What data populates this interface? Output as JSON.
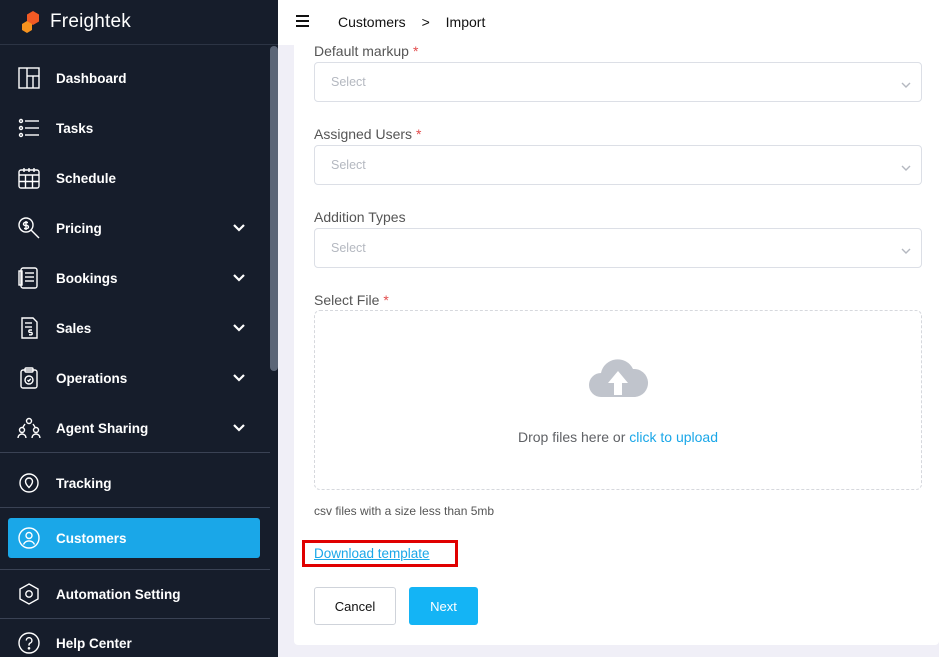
{
  "brand": {
    "name": "Freightek",
    "accent": "#f15a24"
  },
  "sidebar": {
    "items": [
      {
        "label": "Dashboard",
        "icon": "dashboard-icon",
        "expandable": false
      },
      {
        "label": "Tasks",
        "icon": "tasks-icon",
        "expandable": false
      },
      {
        "label": "Schedule",
        "icon": "calendar-icon",
        "expandable": false
      },
      {
        "label": "Pricing",
        "icon": "pricing-search-icon",
        "expandable": true
      },
      {
        "label": "Bookings",
        "icon": "bookings-icon",
        "expandable": true
      },
      {
        "label": "Sales",
        "icon": "sales-invoice-icon",
        "expandable": true
      },
      {
        "label": "Operations",
        "icon": "clipboard-icon",
        "expandable": true
      },
      {
        "label": "Agent Sharing",
        "icon": "agents-icon",
        "expandable": true
      },
      {
        "label": "Tracking",
        "icon": "location-pin-icon",
        "expandable": false
      },
      {
        "label": "Customers",
        "icon": "customer-icon",
        "expandable": false,
        "active": true
      },
      {
        "label": "Automation Setting",
        "icon": "hexagon-gear-icon",
        "expandable": false
      },
      {
        "label": "Help Center",
        "icon": "help-icon",
        "expandable": false
      }
    ],
    "active_color": "#1aa7e8"
  },
  "header": {
    "breadcrumb": [
      "Customers",
      ">",
      "Import"
    ]
  },
  "form": {
    "default_markup": {
      "label": "Default markup",
      "required": "*",
      "placeholder": "Select"
    },
    "assigned_users": {
      "label": "Assigned Users",
      "required": "*",
      "placeholder": "Select"
    },
    "addition_types": {
      "label": "Addition Types",
      "placeholder": "Select"
    },
    "select_file": {
      "label": "Select File",
      "required": "*",
      "drop_text": "Drop files here or",
      "drop_link": "click to upload",
      "hint": "csv files with a size less than 5mb"
    },
    "download_template": "Download template",
    "cancel_label": "Cancel",
    "next_label": "Next"
  }
}
